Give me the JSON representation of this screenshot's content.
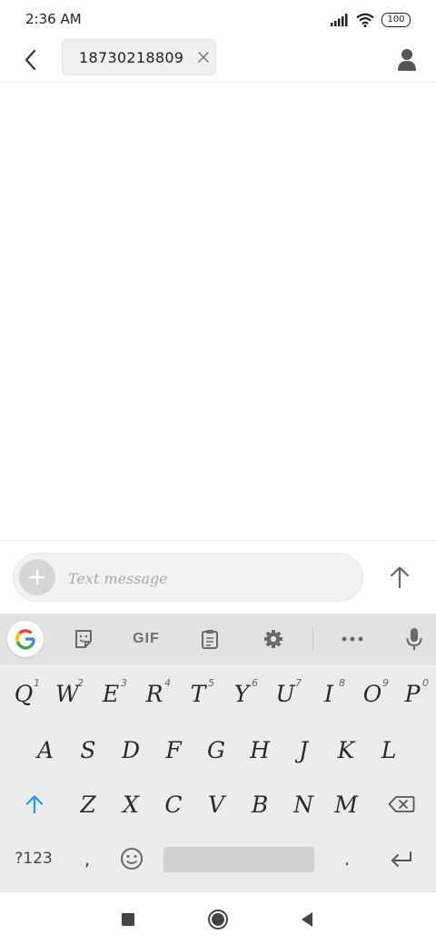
{
  "status_bar": {
    "time": "2:36 AM",
    "battery": "100",
    "icons": [
      "signal-icon",
      "wifi-icon",
      "battery-icon"
    ]
  },
  "header": {
    "recipient": "18730218809",
    "icons": [
      "back-arrow-icon",
      "close-icon",
      "contact-person-icon"
    ]
  },
  "composer": {
    "placeholder": "Text message",
    "icons": [
      "plus-icon",
      "send-arrow-up-icon"
    ]
  },
  "keyboard": {
    "toolbar": {
      "gif_label": "GIF",
      "icons": [
        "google-g-icon",
        "sticker-icon",
        "clipboard-icon",
        "gear-icon",
        "more-dots-icon",
        "microphone-icon"
      ]
    },
    "row1": [
      "Q",
      "W",
      "E",
      "R",
      "T",
      "Y",
      "U",
      "I",
      "O",
      "P"
    ],
    "row1_hints": [
      "1",
      "2",
      "3",
      "4",
      "5",
      "6",
      "7",
      "8",
      "9",
      "0"
    ],
    "row2": [
      "A",
      "S",
      "D",
      "F",
      "G",
      "H",
      "J",
      "K",
      "L"
    ],
    "row3": [
      "Z",
      "X",
      "C",
      "V",
      "B",
      "N",
      "M"
    ],
    "symbols_label": "?123",
    "comma": ",",
    "period": ".",
    "icons": [
      "shift-arrow-icon",
      "backspace-icon",
      "emoji-icon",
      "enter-icon"
    ]
  },
  "nav_bar": {
    "icons": [
      "recents-square-icon",
      "home-circle-icon",
      "back-triangle-icon"
    ]
  },
  "colors": {
    "accent": "#2196f3",
    "keyboard_bg": "#ececec",
    "toolbar_bg": "#e2e2e2",
    "composer_bg": "#f2f2f2"
  }
}
